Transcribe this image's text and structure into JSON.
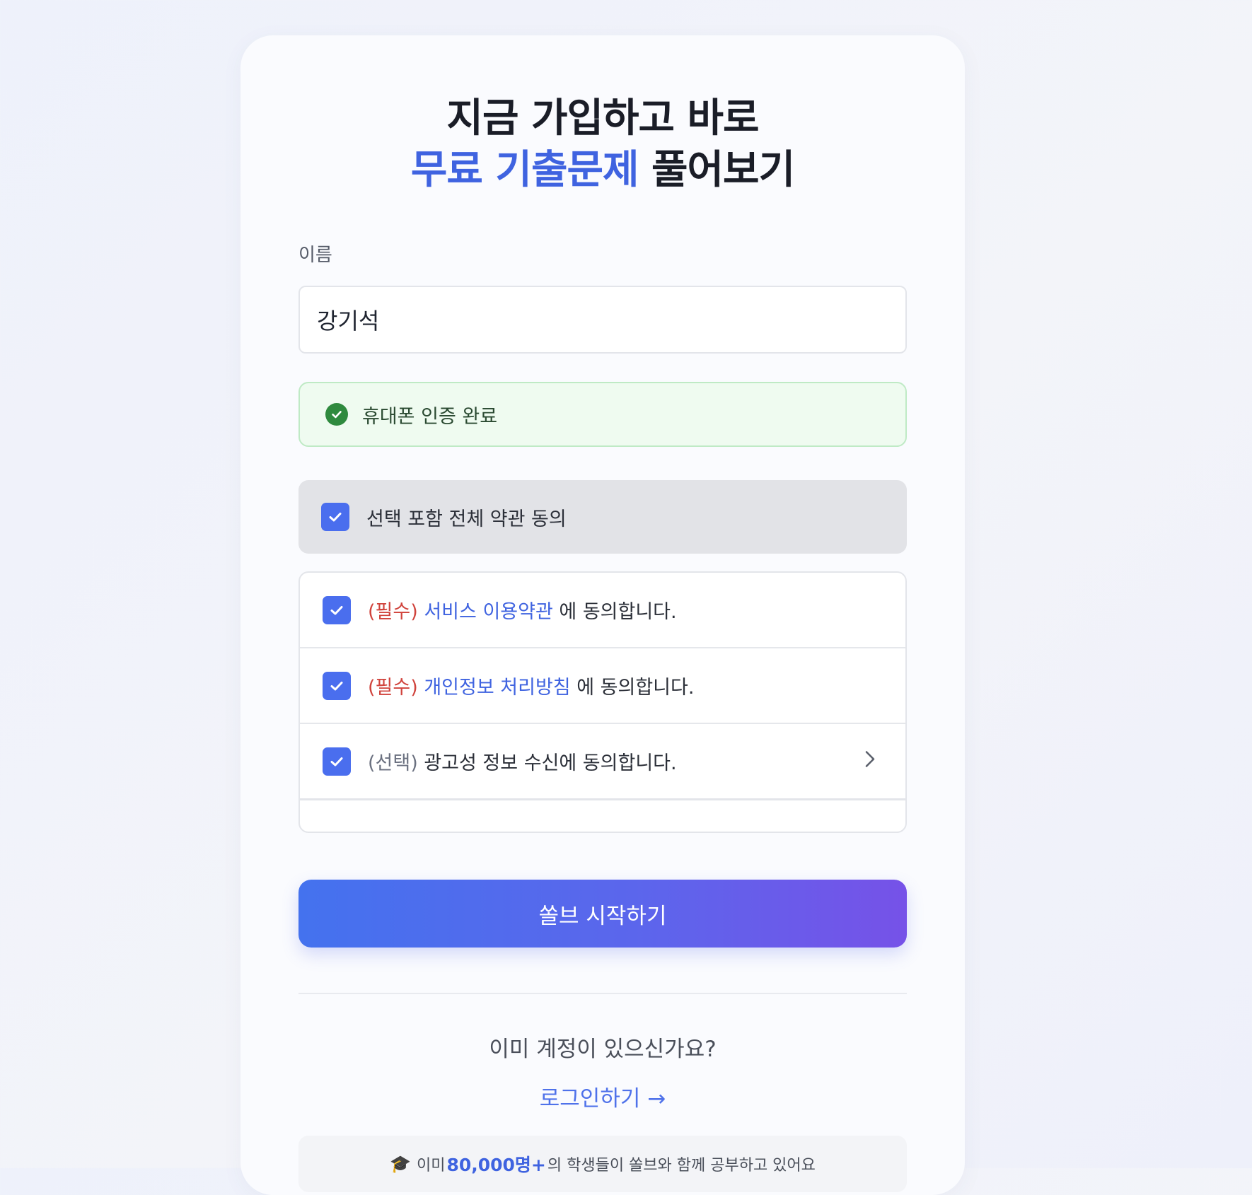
{
  "header": {
    "title_line1": "지금 가입하고 바로",
    "title_line2_accent": "무료 기출문제",
    "title_line2_rest": " 풀어보기"
  },
  "form": {
    "name_label": "이름",
    "name_value": "강기석"
  },
  "verification": {
    "icon": "check-circle-icon",
    "text": "휴대폰 인증 완료",
    "color": "#2f8a3e"
  },
  "agreements": {
    "all": {
      "label": "선택 포함 전체 약관 동의",
      "checked": true
    },
    "items": [
      {
        "tag": "(필수)",
        "link": "서비스 이용약관",
        "suffix": " 에 동의합니다.",
        "checked": true
      },
      {
        "tag": "(필수)",
        "link": "개인정보 처리방침",
        "suffix": " 에 동의합니다.",
        "checked": true
      },
      {
        "tag": "(선택)",
        "text": " 광고성 정보 수신에 동의합니다.",
        "checked": true,
        "icon": "chevron-right-icon"
      }
    ]
  },
  "actions": {
    "start_label": "쏠브 시작하기",
    "have_account": "이미 계정이 있으신가요?",
    "login_label": "로그인하기",
    "login_arrow": "→"
  },
  "footer": {
    "icon": "🎓",
    "prefix": "이미 ",
    "count": "80,000명+",
    "suffix": "의 학생들이 쏠브와 함께 공부하고 있어요"
  },
  "colors": {
    "accent": "#3f63e0",
    "required": "#d0433c",
    "checkbox": "#4a6eee",
    "button_start": "#4472ee",
    "button_end": "#7652e8"
  }
}
